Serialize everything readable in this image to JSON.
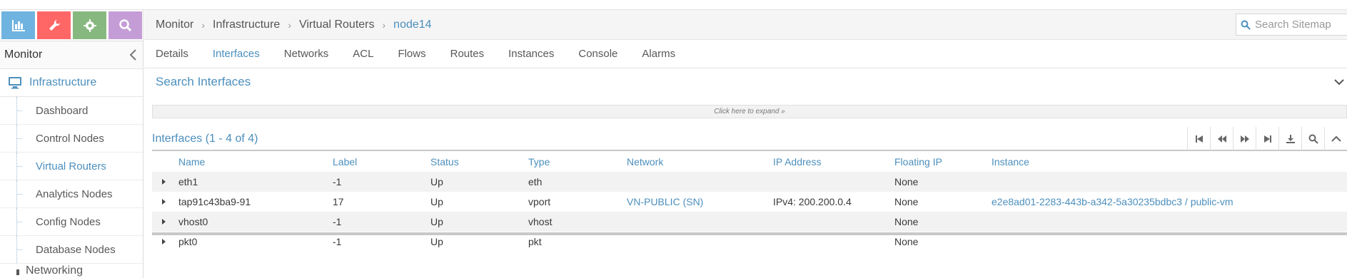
{
  "sidebar": {
    "shortcuts": [
      {
        "icon": "bar-chart-icon",
        "color": "#6fb3e0"
      },
      {
        "icon": "wrench-icon",
        "color": "#ff6666"
      },
      {
        "icon": "gear-icon",
        "color": "#87b87f"
      },
      {
        "icon": "search-icon",
        "color": "#c49dd6"
      }
    ],
    "header": "Monitor",
    "main_item": "Infrastructure",
    "items": [
      {
        "label": "Dashboard"
      },
      {
        "label": "Control Nodes"
      },
      {
        "label": "Virtual Routers",
        "active": true
      },
      {
        "label": "Analytics Nodes"
      },
      {
        "label": "Config Nodes"
      },
      {
        "label": "Database Nodes"
      }
    ],
    "next_item": "Networking"
  },
  "breadcrumb": {
    "items": [
      "Monitor",
      "Infrastructure",
      "Virtual Routers",
      "node14"
    ]
  },
  "search": {
    "placeholder": "Search Sitemap"
  },
  "tabs": [
    "Details",
    "Interfaces",
    "Networks",
    "ACL",
    "Flows",
    "Routes",
    "Instances",
    "Console",
    "Alarms"
  ],
  "active_tab": "Interfaces",
  "search_widget": {
    "title": "Search Interfaces",
    "expand_hint": "Click here to expand »"
  },
  "grid": {
    "title": "Interfaces (1 - 4 of 4)",
    "columns": [
      "Name",
      "Label",
      "Status",
      "Type",
      "Network",
      "IP Address",
      "Floating IP",
      "Instance"
    ],
    "rows": [
      [
        "eth1",
        "-1",
        "Up",
        "eth",
        "",
        "",
        "None",
        ""
      ],
      [
        "tap91c43ba9-91",
        "17",
        "Up",
        "vport",
        "VN-PUBLIC (SN)",
        "IPv4: 200.200.0.4",
        "None",
        "e2e8ad01-2283-443b-a342-5a30235bdbc3 / public-vm"
      ],
      [
        "vhost0",
        "-1",
        "Up",
        "vhost",
        "",
        "",
        "None",
        ""
      ],
      [
        "pkt0",
        "-1",
        "Up",
        "pkt",
        "",
        "",
        "None",
        ""
      ]
    ]
  },
  "colors": {
    "accent": "#4c8fbd"
  }
}
